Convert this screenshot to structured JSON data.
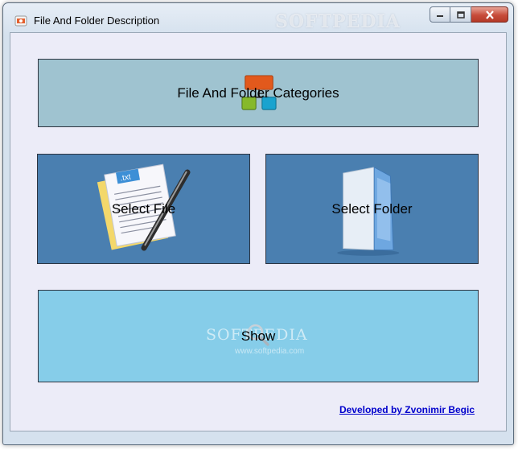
{
  "window": {
    "title": "File And Folder Description",
    "icon": "app-icon",
    "controls": [
      "minimize-icon",
      "maximize-icon",
      "close-icon"
    ],
    "watermark": "SOFTPEDIA"
  },
  "panels": {
    "categories": {
      "label": "File And Folder Categories",
      "icon": "categories-tree-icon"
    },
    "select_file": {
      "label": "Select File",
      "icon": "text-file-pen-icon",
      "file_badge": ".txt"
    },
    "select_folder": {
      "label": "Select Folder",
      "icon": "folder-icon"
    },
    "show": {
      "label": "Show",
      "icon": "magnifier-icon",
      "watermark": "SOFTPEDIA",
      "watermark_url": "www.softpedia.com"
    }
  },
  "footer": {
    "developer_link": "Developed by Zvonimir Begic"
  },
  "colors": {
    "categories_bg": "#9fc3d0",
    "file_folder_bg": "#4a7fb0",
    "show_bg": "#86cde9",
    "client_bg": "#ececf8",
    "link": "#0000cc"
  }
}
